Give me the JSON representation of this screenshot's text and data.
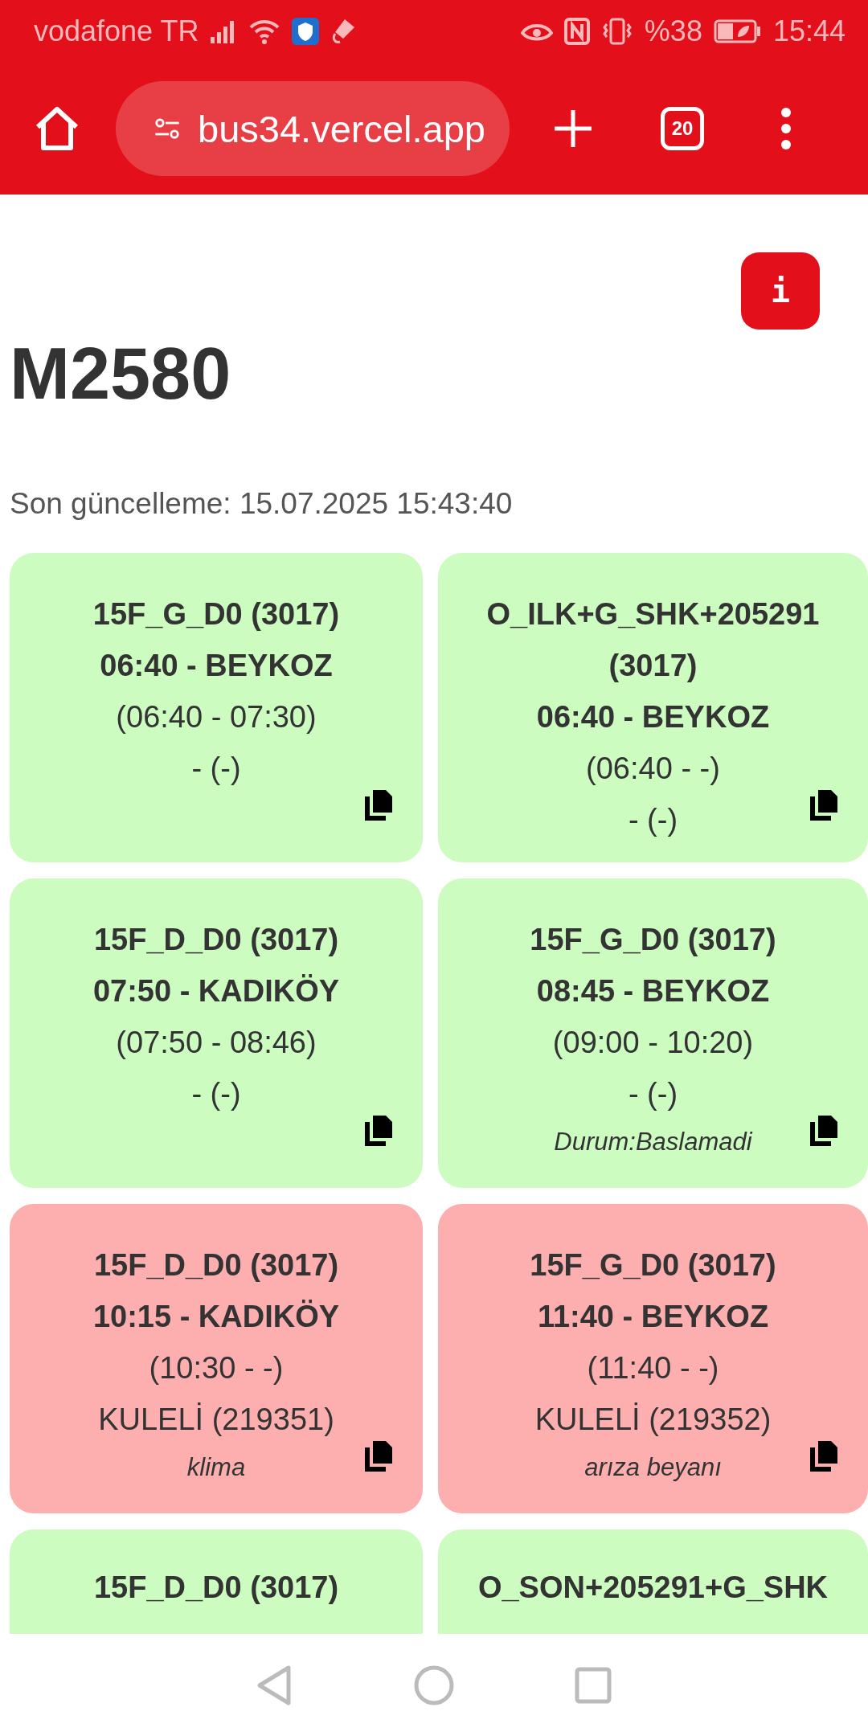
{
  "status_bar": {
    "carrier": "vodafone TR",
    "battery": "%38",
    "time": "15:44"
  },
  "toolbar": {
    "url": "bus34.vercel.app",
    "tab_count": "20"
  },
  "page": {
    "info_button": "i",
    "title": "M2580",
    "updated": "Son güncelleme: 15.07.2025 15:43:40"
  },
  "cards": [
    {
      "color": "#ccfcc0",
      "title": "15F_G_D0 (3017)",
      "trip": "06:40 - BEYKOZ",
      "times": "(06:40 - 07:30)",
      "location": "- (-)"
    },
    {
      "color": "#ccfcc0",
      "title": "O_ILK+G_SHK+205291 (3017)",
      "trip": "06:40 - BEYKOZ",
      "times": "(06:40 - -)",
      "location": "- (-)"
    },
    {
      "color": "#ccfcc0",
      "title": "15F_D_D0 (3017)",
      "trip": "07:50 - KADIKÖY",
      "times": "(07:50 - 08:46)",
      "location": "- (-)"
    },
    {
      "color": "#ccfcc0",
      "title": "15F_G_D0 (3017)",
      "trip": "08:45 - BEYKOZ",
      "times": "(09:00 - 10:20)",
      "location": "- (-)",
      "note": "Durum:Baslamadi"
    },
    {
      "color": "#fdaeae",
      "title": "15F_D_D0 (3017)",
      "trip": "10:15 - KADIKÖY",
      "times": "(10:30 - -)",
      "location": "KULELİ (219351)",
      "note": "klima"
    },
    {
      "color": "#fdaeae",
      "title": "15F_G_D0 (3017)",
      "trip": "11:40 - BEYKOZ",
      "times": "(11:40 - -)",
      "location": "KULELİ (219352)",
      "note": "arıza beyanı"
    },
    {
      "color": "#ccfcc0",
      "title": "15F_D_D0 (3017)"
    },
    {
      "color": "#ccfcc0",
      "title": "O_SON+205291+G_SHK"
    }
  ]
}
